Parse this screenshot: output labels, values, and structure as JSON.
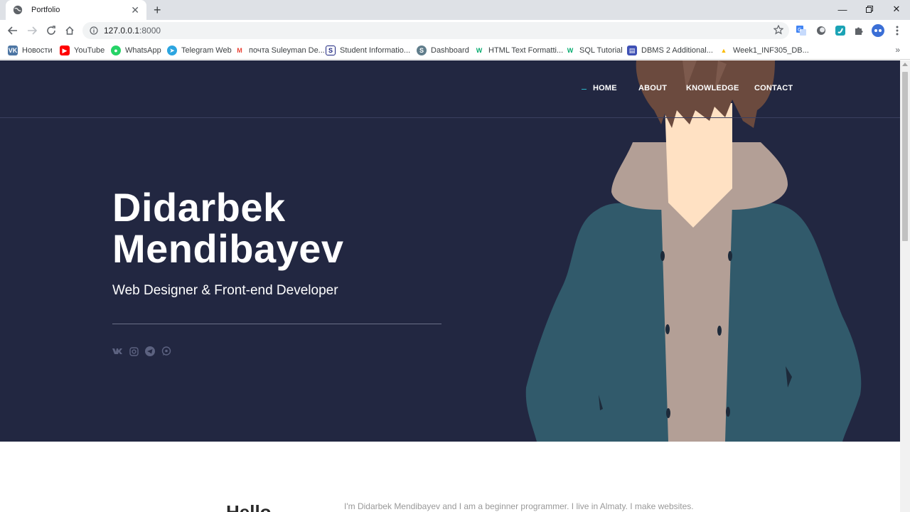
{
  "browser": {
    "tab_title": "Portfolio",
    "url_host": "127.0.0.1",
    "url_port": ":8000",
    "new_tab_glyph": "+",
    "more_glyph": "»"
  },
  "bookmarks": [
    {
      "label": "Новости",
      "icon": "vk-icon",
      "color": "#4c75a3",
      "glyph": "VK"
    },
    {
      "label": "YouTube",
      "icon": "youtube-icon",
      "color": "#ff0000",
      "glyph": "▶"
    },
    {
      "label": "WhatsApp",
      "icon": "whatsapp-icon",
      "color": "#25d366",
      "glyph": "●"
    },
    {
      "label": "Telegram Web",
      "icon": "telegram-icon",
      "color": "#2ca5e0",
      "glyph": "➤"
    },
    {
      "label": "почта Suleyman De...",
      "icon": "gmail-icon",
      "color": "#ea4335",
      "glyph": "M"
    },
    {
      "label": "Student Informatio...",
      "icon": "sdu-icon",
      "color": "#1a237e",
      "glyph": "S"
    },
    {
      "label": "Dashboard",
      "icon": "dashboard-icon",
      "color": "#607d8b",
      "glyph": "S"
    },
    {
      "label": "HTML Text Formatti...",
      "icon": "w3schools-icon",
      "color": "#04aa6d",
      "glyph": "W"
    },
    {
      "label": "SQL Tutorial",
      "icon": "w3schools-icon",
      "color": "#04aa6d",
      "glyph": "W"
    },
    {
      "label": "DBMS 2 Additional...",
      "icon": "forms-icon",
      "color": "#3f51b5",
      "glyph": "▤"
    },
    {
      "label": "Week1_INF305_DB...",
      "icon": "google-drive-icon",
      "color": "#fbbc04",
      "glyph": "▲"
    }
  ],
  "nav": {
    "home": "HOME",
    "about": "ABOUT",
    "knowledge": "KNOWLEDGE",
    "contact": "CONTACT"
  },
  "hero": {
    "name_line1": "Didarbek",
    "name_line2": "Mendibayev",
    "subtitle": "Web Designer & Front-end Developer",
    "socials": [
      "vk-icon",
      "instagram-icon",
      "telegram-icon",
      "whatsapp-icon"
    ]
  },
  "about": {
    "title": "Hello",
    "text": "I'm Didarbek Mendibayev and I am a beginner programmer. I live in Almaty. I make websites."
  },
  "colors": {
    "hero_bg": "#222741",
    "accent": "#2cb5c8",
    "jacket": "#315a6b",
    "hoodie": "#b39f96",
    "skin": "#ffe1c3",
    "hair": "#6b4a3e"
  }
}
